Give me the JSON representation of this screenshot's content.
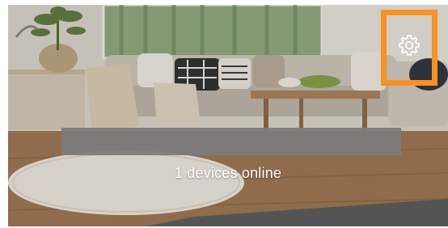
{
  "status": {
    "text": "1 devices online"
  },
  "title_bar": {
    "text": ""
  },
  "settings": {
    "icon": "gear-icon",
    "highlight_color": "#f7931e"
  }
}
